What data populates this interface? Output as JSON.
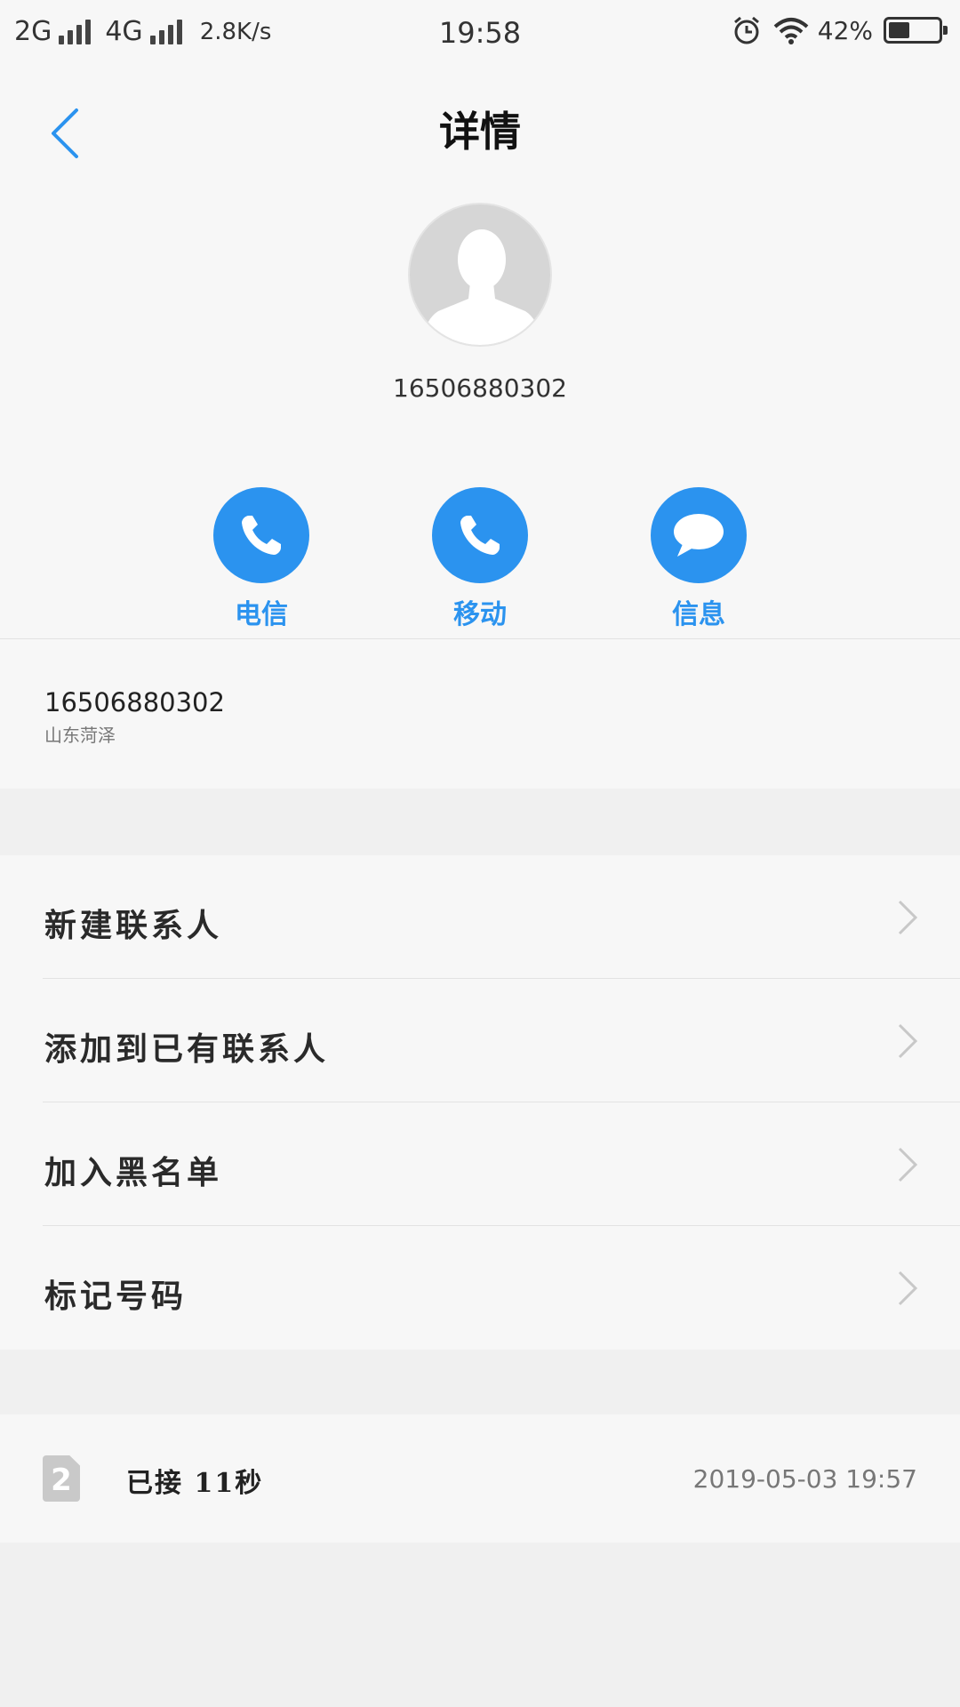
{
  "status_bar": {
    "network1": "2G",
    "network2": "4G",
    "speed": "2.8K/s",
    "time": "19:58",
    "battery": "42%",
    "battery_level": 0.42
  },
  "header": {
    "title": "详情",
    "phone_number": "16506880302"
  },
  "actions": [
    {
      "label": "电信",
      "icon": "phone-icon"
    },
    {
      "label": "移动",
      "icon": "phone-icon"
    },
    {
      "label": "信息",
      "icon": "message-icon"
    }
  ],
  "info": {
    "number": "16506880302",
    "location": "山东菏泽"
  },
  "menu": [
    {
      "label": "新建联系人"
    },
    {
      "label": "添加到已有联系人"
    },
    {
      "label": "加入黑名单"
    },
    {
      "label": "标记号码"
    }
  ],
  "call_log": {
    "sim": "2",
    "status": "已接 11秒",
    "datetime": "2019-05-03 19:57"
  },
  "colors": {
    "accent": "#2b93ef",
    "background": "#f0f0f0",
    "card": "#f7f7f7"
  }
}
